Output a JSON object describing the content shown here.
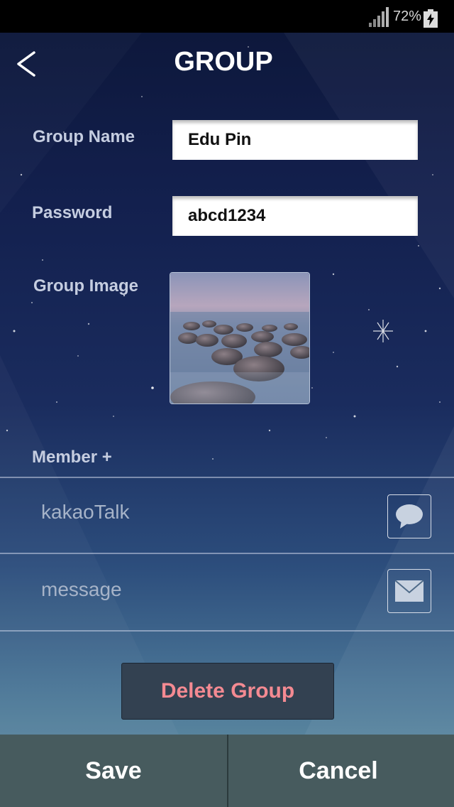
{
  "status_bar": {
    "battery_percent": "72%",
    "signal_icon": "signal-bars-icon",
    "battery_icon": "battery-charging-icon"
  },
  "header": {
    "title": "GROUP",
    "back_icon": "chevron-left-icon"
  },
  "form": {
    "group_name_label": "Group Name",
    "group_name_value": "Edu Pin",
    "password_label": "Password",
    "password_value": "abcd1234",
    "group_image_label": "Group Image",
    "group_image_icon": "photo-thumbnail"
  },
  "members": {
    "label": "Member +",
    "options": [
      {
        "label": "kakaoTalk",
        "icon": "speech-bubble-icon"
      },
      {
        "label": "message",
        "icon": "envelope-icon"
      }
    ]
  },
  "actions": {
    "delete_label": "Delete Group",
    "save_label": "Save",
    "cancel_label": "Cancel"
  },
  "colors": {
    "delete_text": "#f48a92",
    "bottom_bar": "#475b5e"
  }
}
